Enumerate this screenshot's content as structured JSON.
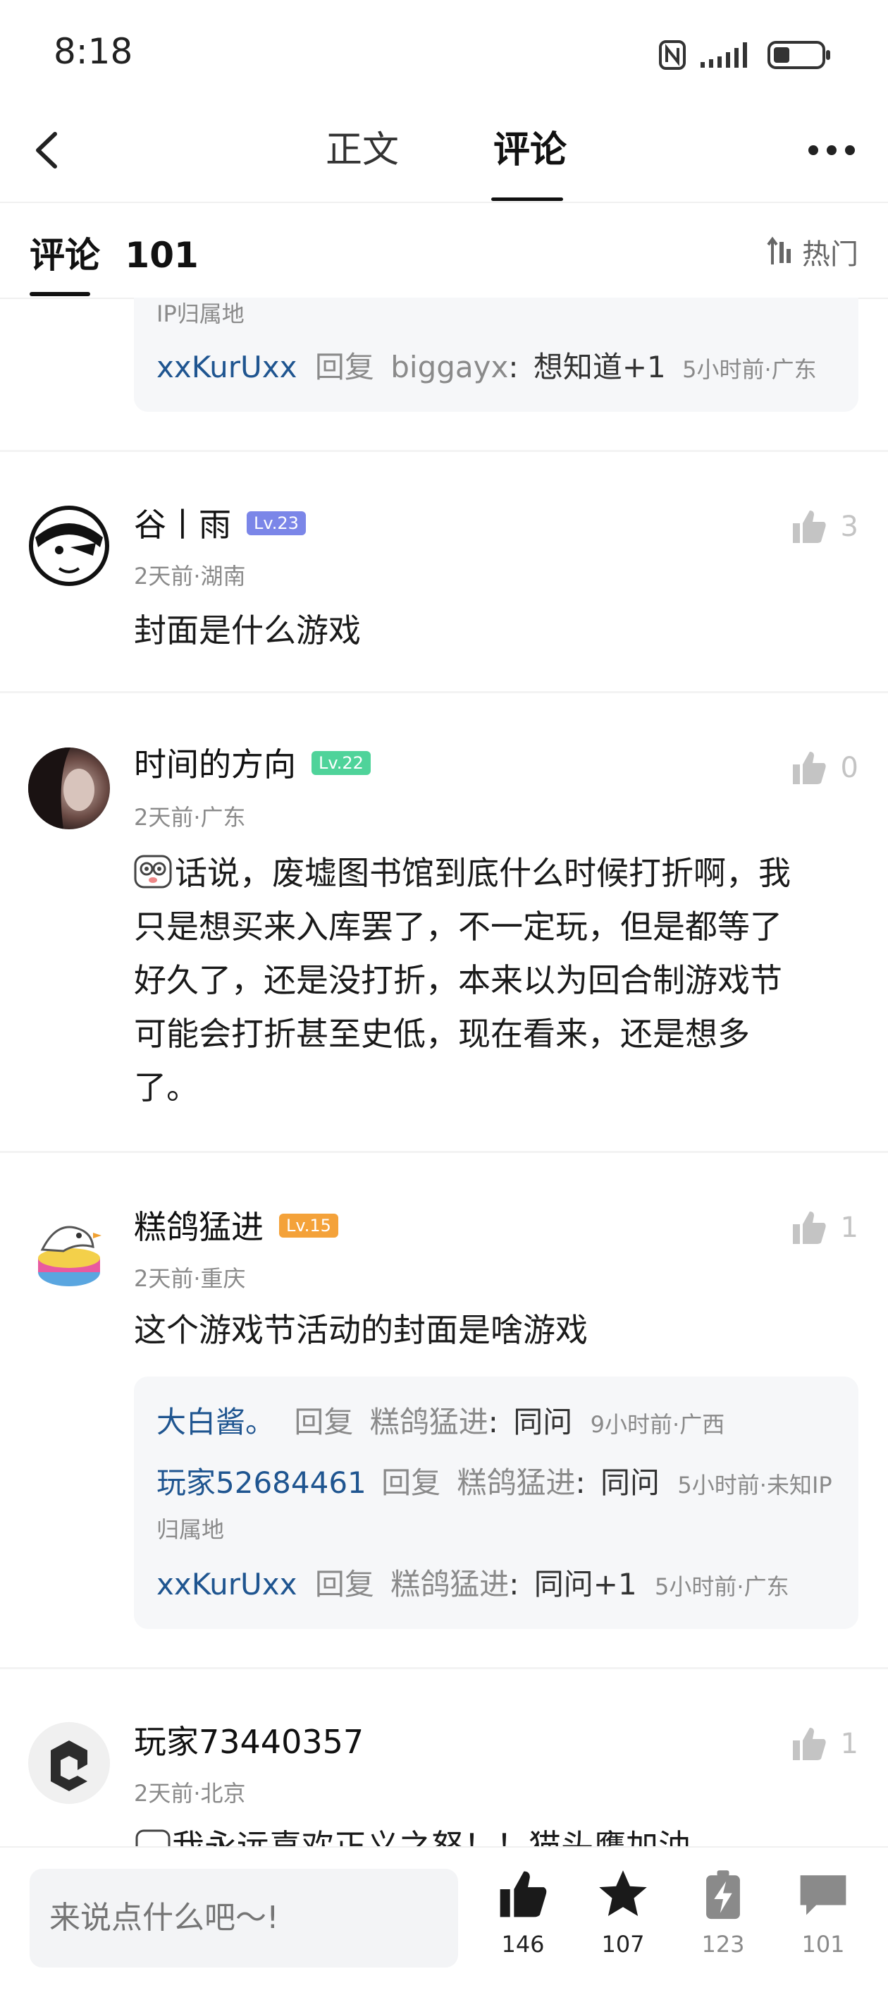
{
  "status": {
    "time": "8:18"
  },
  "nav": {
    "tab_main": "正文",
    "tab_comments": "评论"
  },
  "comments_header": {
    "title": "评论",
    "count": "101",
    "sort": "热门"
  },
  "top_reply": {
    "fragment": "IP归属地",
    "user": "xxKurUxx",
    "reply_word": "回复",
    "target": "biggayx",
    "text": "想知道+1",
    "time": "5小时前·广东"
  },
  "comments": [
    {
      "user": "谷丨雨",
      "level": "Lv.23",
      "level_color": "#7b86e8",
      "meta": "2天前·湖南",
      "likes": "3",
      "text": "封面是什么游戏"
    },
    {
      "user": "时间的方向",
      "level": "Lv.22",
      "level_color": "#4fd39a",
      "meta": "2天前·广东",
      "likes": "0",
      "lines": [
        "话说，废墟图书馆到底什么时候打折啊，我",
        "只是想买来入库罢了，不一定玩，但是都等了",
        "好久了，还是没打折，本来以为回合制游戏节",
        "可能会打折甚至史低，现在看来，还是想多",
        "了。"
      ]
    },
    {
      "user": "糕鸽猛进",
      "level": "Lv.15",
      "level_color": "#f4a23a",
      "meta": "2天前·重庆",
      "likes": "1",
      "text": "这个游戏节活动的封面是啥游戏",
      "replies": [
        {
          "user": "大白酱。",
          "reply_word": "回复",
          "target": "糕鸽猛进",
          "text": "同问",
          "time": "9小时前·广西"
        },
        {
          "user": "玩家52684461",
          "reply_word": "回复",
          "target": "糕鸽猛进",
          "text": "同问",
          "time": "5小时前·未知IP",
          "time2": "归属地"
        },
        {
          "user": "xxKurUxx",
          "reply_word": "回复",
          "target": "糕鸽猛进",
          "text": "同问+1",
          "time": "5小时前·广东"
        }
      ]
    },
    {
      "user": "玩家73440357",
      "meta": "2天前·北京",
      "likes": "1",
      "text": "我永远喜欢正义之怒！！猫头鹰加油"
    }
  ],
  "bottom": {
    "placeholder": "来说点什么吧～!",
    "likes": "146",
    "stars": "107",
    "shares": "123",
    "comments": "101"
  },
  "colors": {
    "link": "#1f5590",
    "muted": "#8a8a8a"
  }
}
